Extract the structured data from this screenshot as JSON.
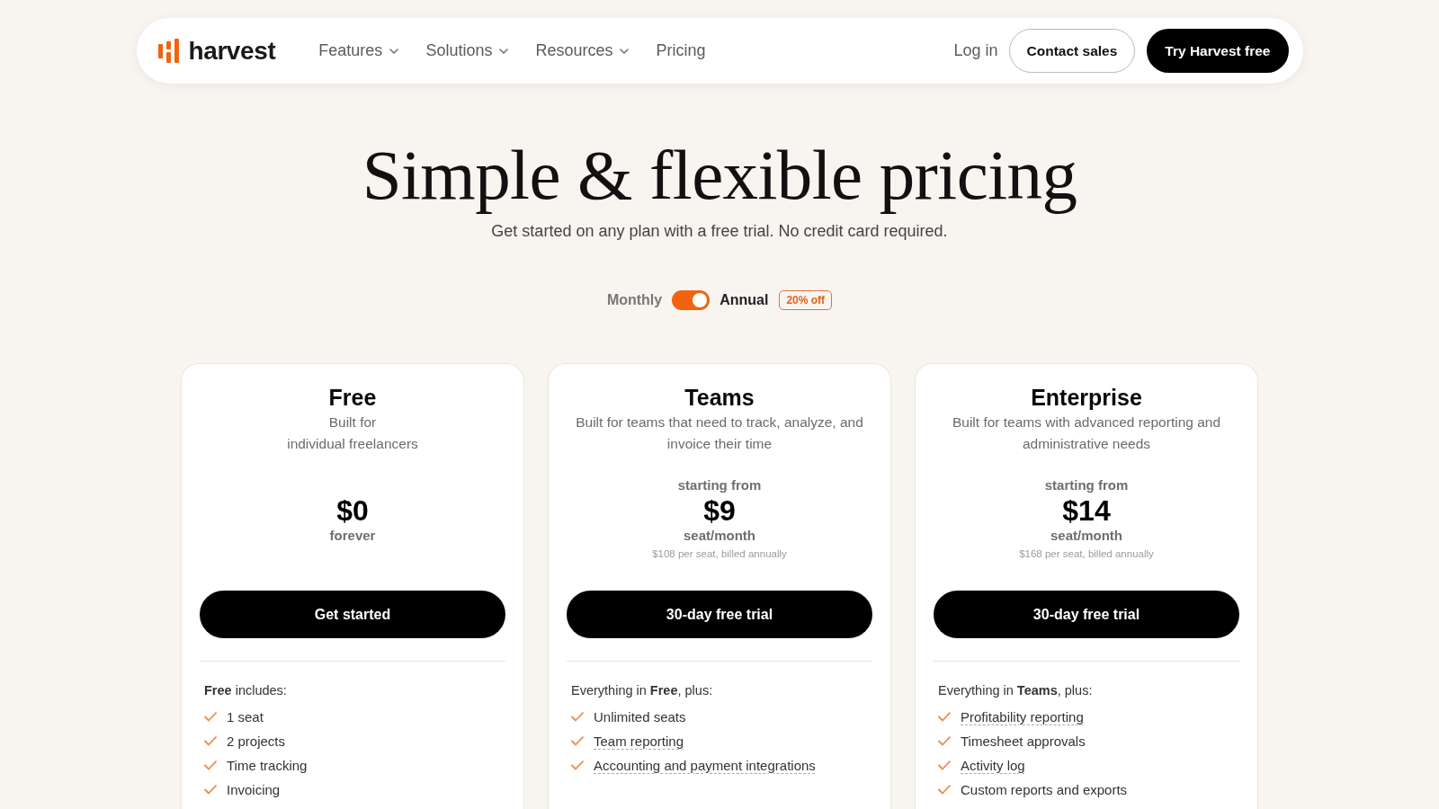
{
  "navbar": {
    "logo": {
      "text": "harvest"
    },
    "menu": [
      {
        "label": "Features",
        "dropdown": true
      },
      {
        "label": "Solutions",
        "dropdown": true
      },
      {
        "label": "Resources",
        "dropdown": true
      },
      {
        "label": "Pricing",
        "dropdown": false
      }
    ],
    "actions": [
      {
        "label": "Log in",
        "kind": "link"
      },
      {
        "label": "Contact sales",
        "kind": "outline"
      },
      {
        "label": "Try Harvest free",
        "kind": "primary"
      }
    ]
  },
  "hero": {
    "title": "Simple & flexible pricing",
    "subtitle": "Get started on any plan with a free trial. No credit card required."
  },
  "billing_toggle": {
    "off_label": "Monthly",
    "on_label": "Annual",
    "on": true,
    "badge": "20% off"
  },
  "plans": [
    {
      "name": "Free",
      "description": "Built for\nindividual freelancers",
      "price": "$0",
      "period": "forever",
      "button": "Get started",
      "includes": "**Free** includes:",
      "features": [
        {
          "text": "1 seat",
          "underlined": false
        },
        {
          "text": "2 projects",
          "underlined": false
        },
        {
          "text": "Time tracking",
          "underlined": false
        },
        {
          "text": "Invoicing",
          "underlined": false
        }
      ]
    },
    {
      "name": "Teams",
      "description": "Built for teams that need to track, analyze, and invoice their time",
      "price_prefix": "starting from",
      "price": "$9",
      "period": "seat/month",
      "note": "$108 per seat, billed annually",
      "button": "30-day free trial",
      "includes": "Everything in **Free**, plus:",
      "features": [
        {
          "text": "Unlimited seats",
          "underlined": false
        },
        {
          "text": "Team reporting",
          "underlined": true
        },
        {
          "text": "Accounting and payment integrations",
          "underlined": true
        }
      ]
    },
    {
      "name": "Enterprise",
      "description": "Built for teams with advanced reporting and administrative needs",
      "price_prefix": "starting from",
      "price": "$14",
      "period": "seat/month",
      "note": "$168 per seat, billed annually",
      "button": "30-day free trial",
      "includes": "Everything in **Teams**, plus:",
      "features": [
        {
          "text": "Profitability reporting",
          "underlined": true
        },
        {
          "text": "Timesheet approvals",
          "underlined": false
        },
        {
          "text": "Activity log",
          "underlined": true
        },
        {
          "text": "Custom reports and exports",
          "underlined": false
        }
      ]
    }
  ]
}
